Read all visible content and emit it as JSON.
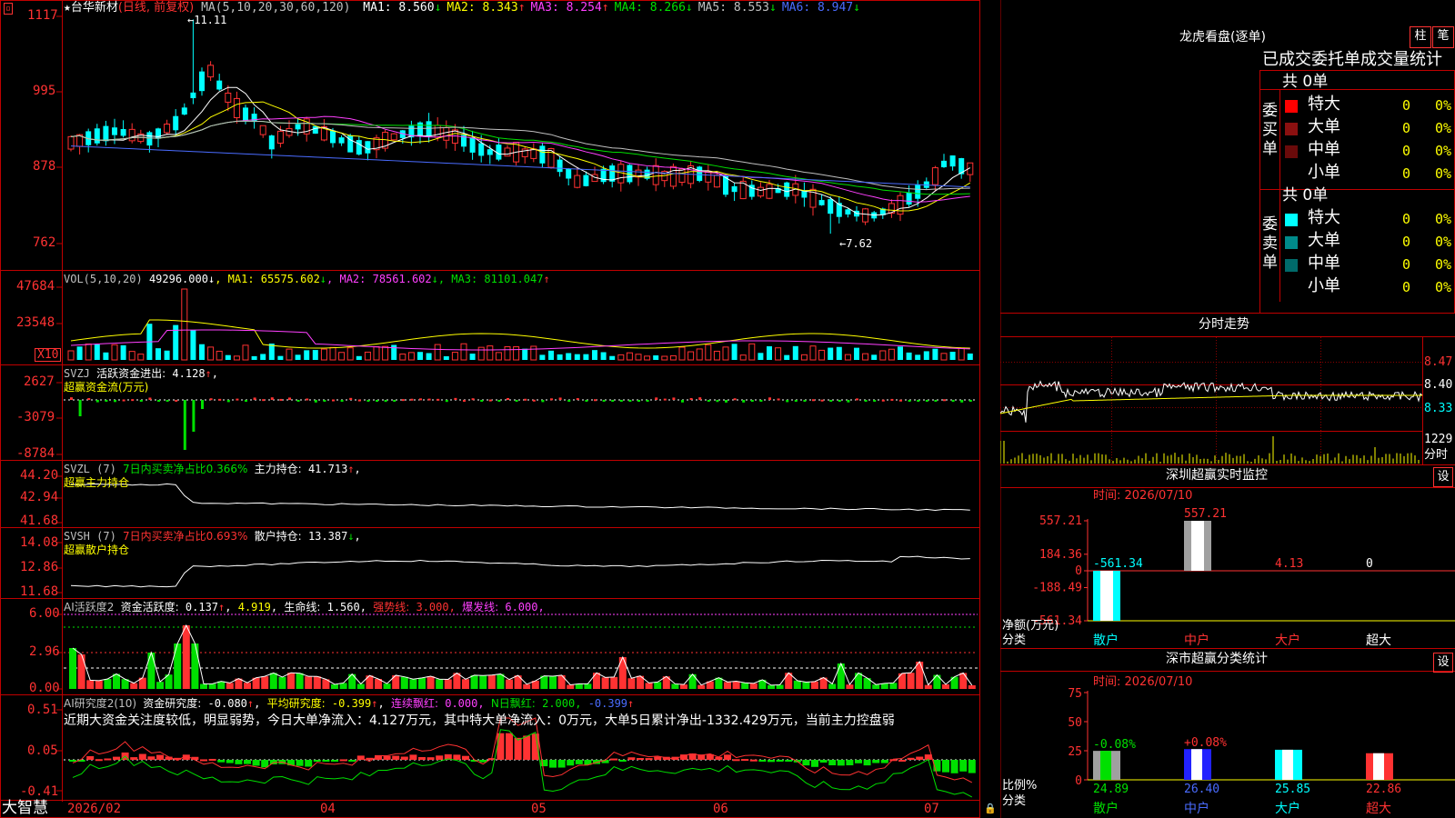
{
  "stock": {
    "star": "★",
    "name": "台华新材",
    "mode": "(日线, 前复权)"
  },
  "ma_header": {
    "label": "MA(5,10,20,30,60,120)",
    "items": [
      {
        "k": "MA1:",
        "v": "8.560",
        "a": "↓",
        "color": "#ffffff"
      },
      {
        "k": "MA2:",
        "v": "8.343",
        "a": "↑",
        "color": "#ffff00"
      },
      {
        "k": "MA3:",
        "v": "8.254",
        "a": "↑",
        "color": "#ff40ff"
      },
      {
        "k": "MA4:",
        "v": "8.266",
        "a": "↓",
        "color": "#00e000"
      },
      {
        "k": "MA5:",
        "v": "8.553",
        "a": "↓",
        "color": "#c0c0c0"
      },
      {
        "k": "MA6:",
        "v": "8.947",
        "a": "↓",
        "color": "#4a6cff"
      }
    ]
  },
  "price_axis": [
    "1117",
    "995",
    "878",
    "762"
  ],
  "price_annotations": {
    "high": "11.11",
    "low": "7.62"
  },
  "vol_header": {
    "label": "VOL(5,10,20)",
    "v": "49296.000",
    "a": "↓",
    "items": [
      {
        "k": "MA1:",
        "v": "65575.602",
        "a": "↓",
        "color": "#ffff00"
      },
      {
        "k": "MA2:",
        "v": "78561.602",
        "a": "↓",
        "color": "#ff40ff"
      },
      {
        "k": "MA3:",
        "v": "81101.047",
        "a": "↑",
        "color": "#00e000"
      }
    ]
  },
  "vol_axis": [
    "47684",
    "23548"
  ],
  "vol_unit": "X10",
  "svzj": {
    "label": "SVZJ",
    "desc": "活跃资金进出:",
    "v": "4.128",
    "a": "↑",
    "sub": "超赢资金流(万元)",
    "axis": [
      "2627",
      "-3079",
      "-8784"
    ]
  },
  "svzl": {
    "label": "SVZL (7)",
    "desc": "7日内买卖净占比0.366%",
    "k": "主力持仓:",
    "v": "41.713",
    "a": "↑",
    "sub": "超赢主力持仓",
    "axis": [
      "44.20",
      "42.94",
      "41.68"
    ]
  },
  "svsh": {
    "label": "SVSH (7)",
    "desc": "7日内买卖净占比0.693%",
    "k": "散户持仓:",
    "v": "13.387",
    "a": "↓",
    "sub": "超赢散户持仓",
    "axis": [
      "14.08",
      "12.86",
      "11.68"
    ]
  },
  "ai1": {
    "label": "AI活跃度2",
    "k": "资金活跃度:",
    "v": "0.137",
    "a": "↑",
    "v2": "4.919",
    "k3": "生命线:",
    "v3": "1.560",
    "k4": "强势线:",
    "v4": "3.000",
    "k5": "爆发线:",
    "v5": "6.000",
    "axis": [
      "6.00",
      "2.96",
      "0.00"
    ]
  },
  "ai2": {
    "label": "AI研究度2(10)",
    "k": "资金研究度:",
    "v": "-0.080",
    "a": "↑",
    "k2": "平均研究度:",
    "v2": "-0.399",
    "a2": "↑",
    "k3": "连续飘红:",
    "v3": "0.000",
    "k4": "N日飘红:",
    "v4": "2.000",
    "v5": "-0.399",
    "a5": "↑",
    "axis": [
      "0.51",
      "0.05",
      "-0.41"
    ],
    "comment": "近期大资金关注度较低，明显弱势，今日大单净流入：4.127万元，其中特大单净流入：0万元，大单5日累计净出-1332.429万元，当前主力控盘弱"
  },
  "date_axis": {
    "brand": "大智慧",
    "labels": [
      "2026/02",
      "04",
      "05",
      "06",
      "07"
    ]
  },
  "lhb": {
    "title": "龙虎看盘(逐单)",
    "btn1": "柱",
    "btn2": "笔",
    "header": "已成交委托单成交量统计",
    "buy": {
      "side": "委买单",
      "total": "共 0单",
      "rows": [
        {
          "n": "特大",
          "v": "0",
          "p": "0%",
          "c": "#ff0000"
        },
        {
          "n": "大单",
          "v": "0",
          "p": "0%",
          "c": "#8b1010"
        },
        {
          "n": "中单",
          "v": "0",
          "p": "0%",
          "c": "#6a0a0a"
        },
        {
          "n": "小单",
          "v": "0",
          "p": "0%",
          "c": ""
        }
      ]
    },
    "sell": {
      "side": "委卖单",
      "total": "共 0单",
      "rows": [
        {
          "n": "特大",
          "v": "0",
          "p": "0%",
          "c": "#00ffff"
        },
        {
          "n": "大单",
          "v": "0",
          "p": "0%",
          "c": "#008b8b"
        },
        {
          "n": "中单",
          "v": "0",
          "p": "0%",
          "c": "#006a6a"
        },
        {
          "n": "小单",
          "v": "0",
          "p": "0%",
          "c": ""
        }
      ]
    }
  },
  "intraday": {
    "title": "分时走势",
    "axis": [
      "8.47",
      "8.40",
      "8.33"
    ],
    "vol_label": "1229",
    "vol_unit": "分时"
  },
  "sz_monitor": {
    "title": "深圳超赢实时监控",
    "btn": "设",
    "time": "时间: 2026/07/10",
    "axis": [
      "557.21",
      "184.36",
      "0",
      "-188.49",
      "-561.34"
    ],
    "values": [
      {
        "cat": "散户",
        "v": -561.34,
        "label": "-561.34"
      },
      {
        "cat": "中户",
        "v": 557.21,
        "label": "557.21"
      },
      {
        "cat": "大户",
        "v": 4.13,
        "label": "4.13"
      },
      {
        "cat": "超大",
        "v": 0,
        "label": "0"
      }
    ],
    "ylabel": "净额(万元)",
    "xlabel": "分类"
  },
  "sz_class": {
    "title": "深市超赢分类统计",
    "btn": "设",
    "time": "时间: 2026/07/10",
    "axis": [
      "75",
      "50",
      "25",
      "0"
    ],
    "values": [
      {
        "cat": "散户",
        "v": 24.89,
        "chg": "-0.08%"
      },
      {
        "cat": "中户",
        "v": 26.4,
        "chg": "+0.08%"
      },
      {
        "cat": "大户",
        "v": 25.85,
        "chg": ""
      },
      {
        "cat": "超大",
        "v": 22.86,
        "chg": ""
      }
    ],
    "ylabel": "比例%",
    "xlabel": "分类"
  },
  "chart_data": [
    {
      "type": "bar",
      "title": "深圳超赢实时监控",
      "categories": [
        "散户",
        "中户",
        "大户",
        "超大"
      ],
      "values": [
        -561.34,
        557.21,
        4.13,
        0
      ],
      "ylabel": "净额(万元)",
      "xlabel": "分类",
      "ylim": [
        -561.34,
        557.21
      ]
    },
    {
      "type": "bar",
      "title": "深市超赢分类统计",
      "categories": [
        "散户",
        "中户",
        "大户",
        "超大"
      ],
      "values": [
        24.89,
        26.4,
        25.85,
        22.86
      ],
      "ylabel": "比例%",
      "xlabel": "分类",
      "ylim": [
        0,
        75
      ]
    }
  ]
}
